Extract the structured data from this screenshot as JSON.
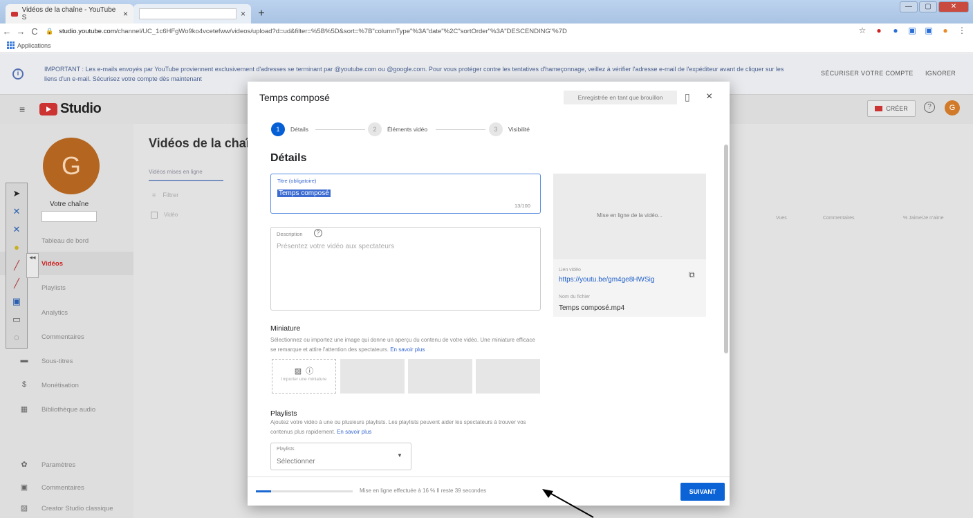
{
  "browser": {
    "tabs": [
      {
        "label": "Vidéos de la chaîne - YouTube S",
        "close": "×"
      },
      {
        "label": "",
        "close": "×"
      }
    ],
    "newtab": "+",
    "window_buttons": [
      "—",
      "▢",
      "✕"
    ],
    "url_domain": "studio.youtube.com",
    "url_rest": "/channel/UC_1c6HFgWo9ko4vcetefww/videos/upload?d=ud&filter=%5B%5D&sort=%7B\"columnType\"%3A\"date\"%2C\"sortOrder\"%3A\"DESCENDING\"%7D",
    "bookmarks_label": "Applications"
  },
  "banner": {
    "message": "IMPORTANT : Les e-mails envoyés par YouTube proviennent exclusivement d'adresses se terminant par @youtube.com ou @google.com. Pour vous protéger contre les tentatives d'hameçonnage, veillez à vérifier l'adresse e-mail de l'expéditeur avant de cliquer sur les liens d'un e-mail. Sécurisez votre compte dès maintenant",
    "secure_label": "SÉCURISER VOTRE COMPTE",
    "ignore_label": "IGNORER"
  },
  "header": {
    "logo_text": "Studio",
    "create_label": "CRÉER",
    "avatar_letter": "G"
  },
  "sidebar": {
    "avatar_letter": "G",
    "channel_label": "Votre chaîne",
    "items": [
      {
        "label": "Tableau de bord",
        "icon": "⊞"
      },
      {
        "label": "Vidéos",
        "icon": "▶"
      },
      {
        "label": "Playlists",
        "icon": "≡"
      },
      {
        "label": "Analytics",
        "icon": "▥"
      },
      {
        "label": "Commentaires",
        "icon": "▤"
      },
      {
        "label": "Sous-titres",
        "icon": "▬"
      },
      {
        "label": "Monétisation",
        "icon": "$"
      },
      {
        "label": "Bibliothèque audio",
        "icon": "▦"
      },
      {
        "label": "Paramètres",
        "icon": "✿"
      },
      {
        "label": "Commentaires",
        "icon": "▣"
      },
      {
        "label": "Creator Studio classique",
        "icon": "▨"
      }
    ]
  },
  "main": {
    "title": "Vidéos de la chaîne",
    "tab_label": "Vidéos mises en ligne",
    "filter_label": "Filtrer",
    "video_col": "Vidéo",
    "col_views": "Vues",
    "col_comments": "Commentaires",
    "col_likes": "% Jaime/Je n'aime"
  },
  "modal": {
    "title": "Temps composé",
    "draft_badge": "Enregistrée en tant que brouillon",
    "close": "×",
    "steps": [
      {
        "num": "1",
        "label": "Détails"
      },
      {
        "num": "2",
        "label": "Éléments vidéo"
      },
      {
        "num": "3",
        "label": "Visibilité"
      }
    ],
    "section_title": "Détails",
    "title_field": {
      "label": "Titre (obligatoire)",
      "value": "Temps composé",
      "count": "13/100"
    },
    "description": {
      "label": "Description",
      "placeholder": "Présentez votre vidéo aux spectateurs"
    },
    "thumbnail": {
      "title": "Miniature",
      "desc": "Sélectionnez ou importez une image qui donne un aperçu du contenu de votre vidéo. Une miniature efficace se remarque et attire l'attention des spectateurs.",
      "link": "En savoir plus",
      "upload_label": "Importer une miniature"
    },
    "playlists": {
      "title": "Playlists",
      "desc": "Ajoutez votre vidéo à une ou plusieurs playlists. Les playlists peuvent aider les spectateurs à trouver vos contenus plus rapidement.",
      "link": "En savoir plus",
      "select_label": "Playlists",
      "select_value": "Sélectionner"
    },
    "preview": {
      "uploading": "Mise en ligne de la vidéo...",
      "link_label": "Lien vidéo",
      "link": "https://youtu.be/gm4ge8HWSig",
      "file_label": "Nom du fichier",
      "file": "Temps composé.mp4"
    },
    "footer": {
      "progress": 0.16,
      "progress_text": "Mise en ligne effectuée à 16 %    Il reste 39 secondes",
      "next_label": "SUIVANT"
    }
  },
  "colors": {
    "accent": "#065fd4",
    "youtube_red": "#cc3333",
    "avatar": "#b4651f"
  }
}
